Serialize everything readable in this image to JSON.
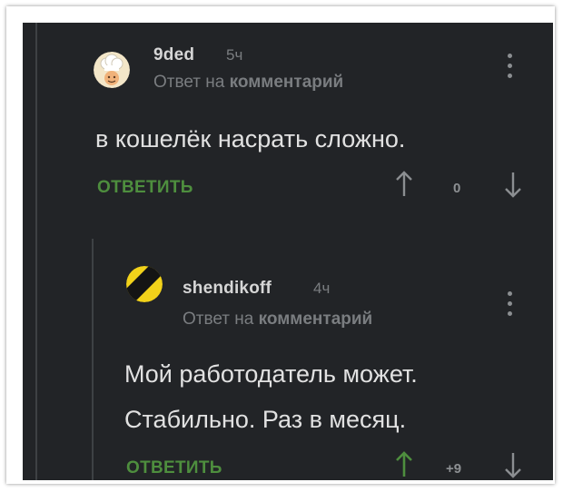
{
  "colors": {
    "background": "#222427",
    "text": "#e1e1e1",
    "muted": "#7a7d80",
    "reply_green": "#4e8e3e",
    "upvoted_green": "#4e8e3e",
    "arrow_gray": "#8b8e91"
  },
  "comments": [
    {
      "author": "9ded",
      "time": "5ч",
      "reply_prefix": "Ответ на",
      "reply_target": "комментарий",
      "text": "в кошелёк насрать сложно.",
      "reply_label": "ОТВЕТИТЬ",
      "score": "0",
      "avatar_icon": "chef-hat-avatar-icon",
      "upvoted": false
    },
    {
      "author": "shendikoff",
      "time": "4ч",
      "reply_prefix": "Ответ на",
      "reply_target": "комментарий",
      "text_lines": [
        "Мой работодатель может.",
        "Стабильно. Раз в месяц."
      ],
      "reply_label": "ОТВЕТИТЬ",
      "score": "+9",
      "avatar_icon": "yellow-black-striped-avatar-icon",
      "upvoted": true
    }
  ]
}
